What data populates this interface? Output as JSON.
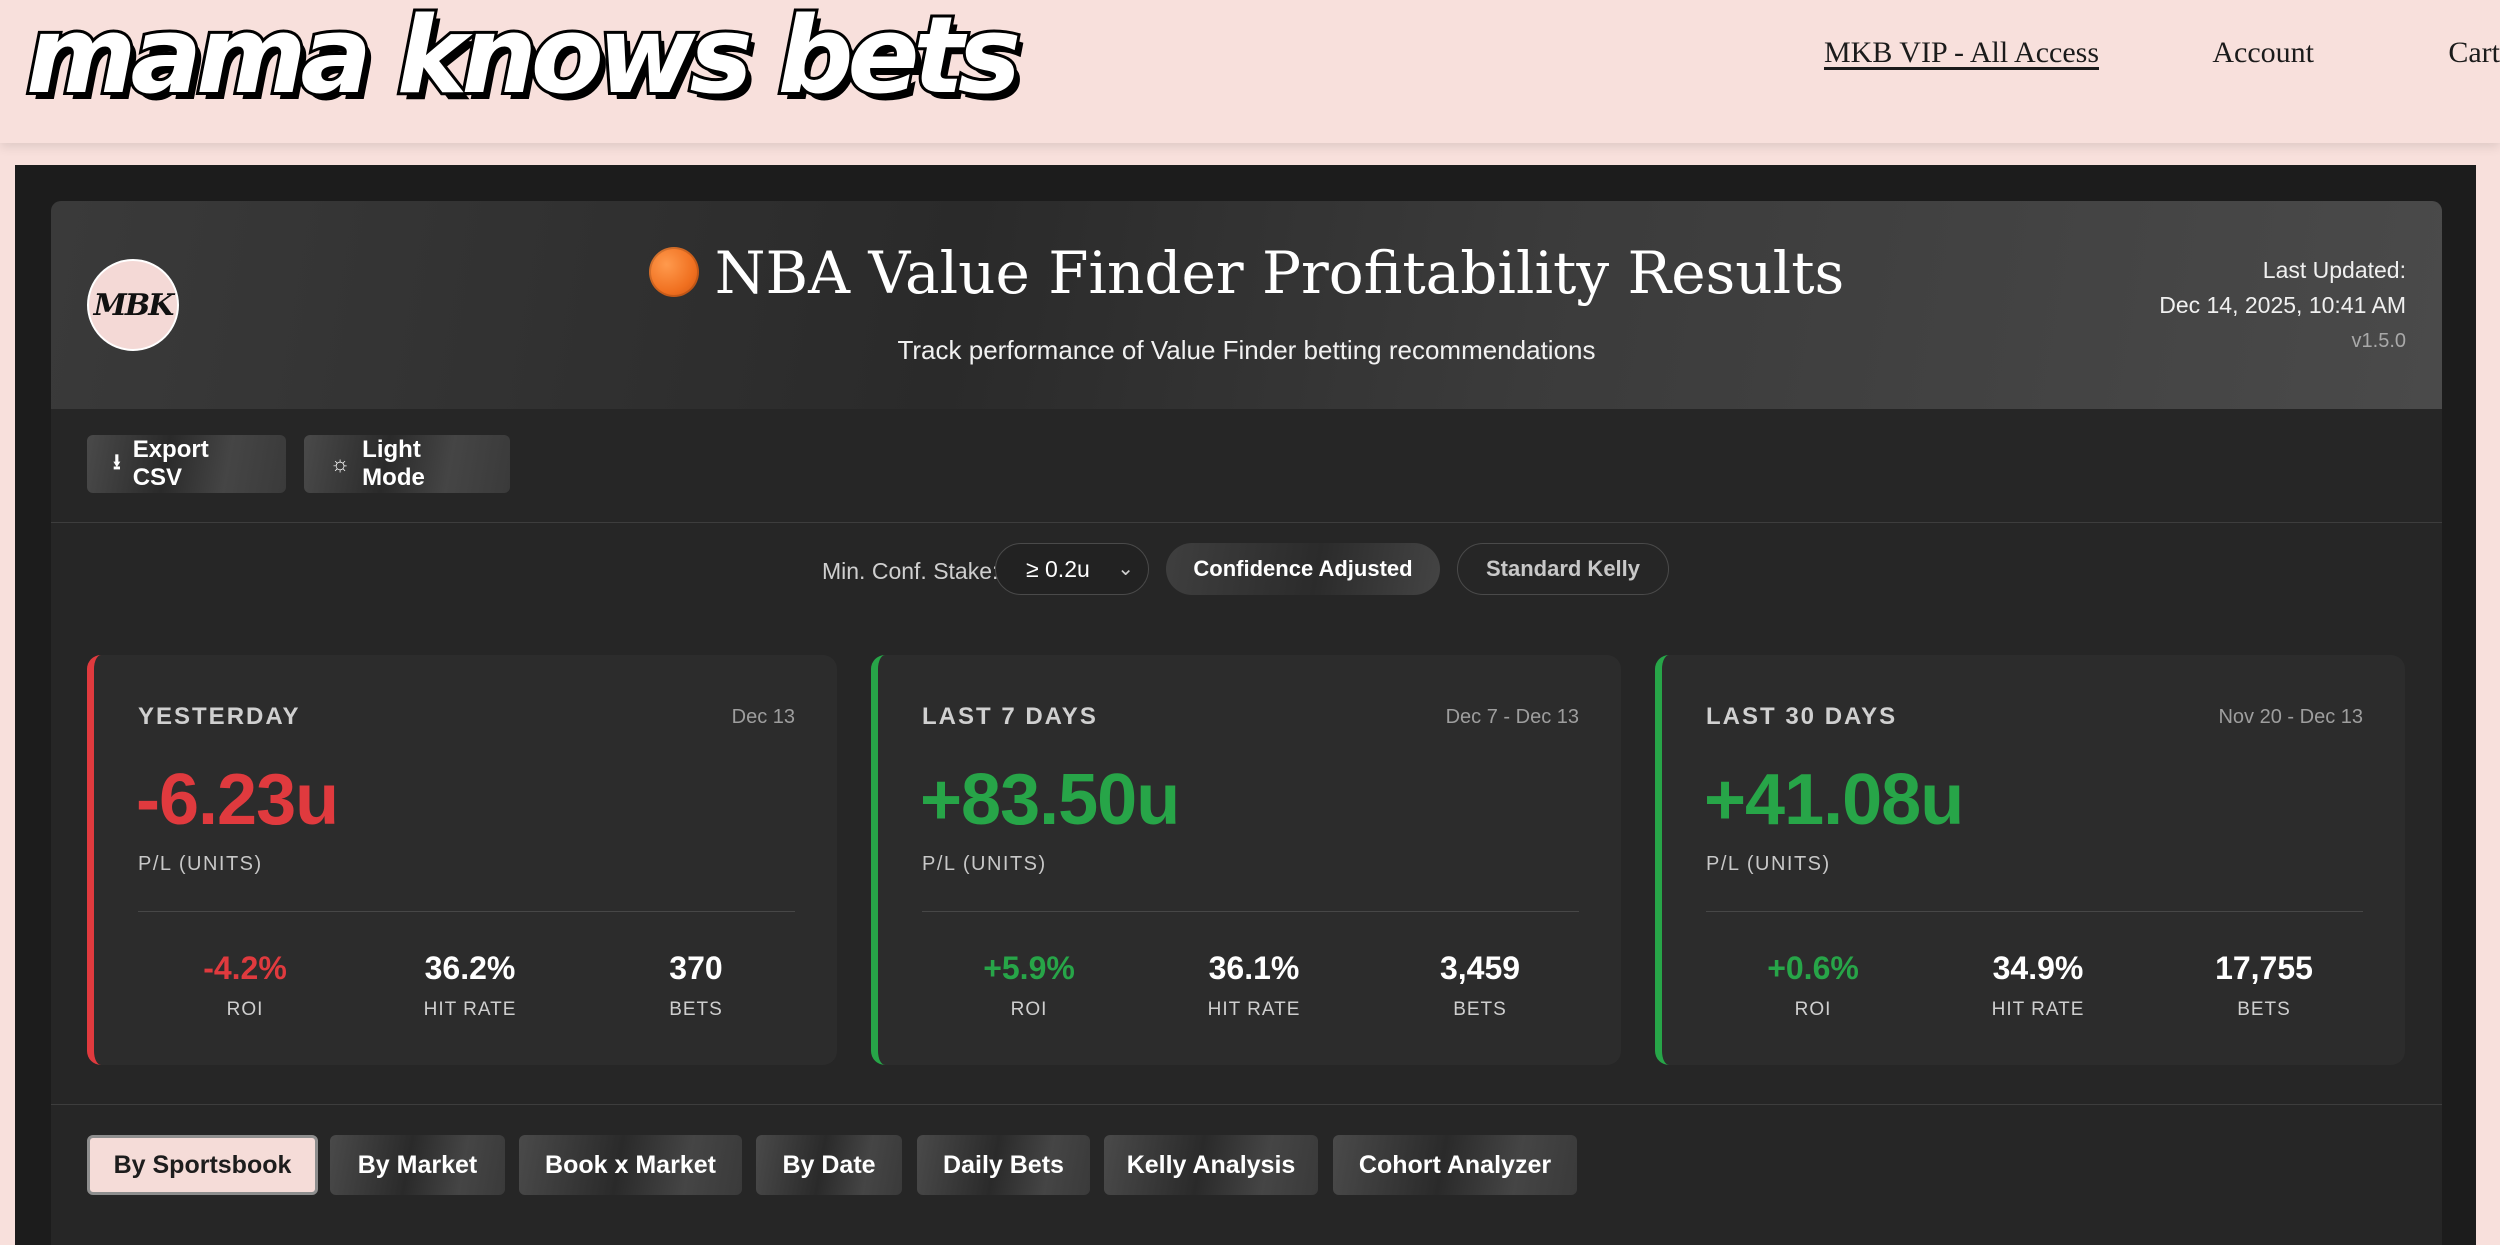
{
  "site": {
    "brand": "mama knows bets",
    "nav": [
      "MKB VIP - All Access",
      "Account",
      "Cart"
    ]
  },
  "hero": {
    "logo_text": "MBK",
    "title": "NBA Value Finder Profitability Results",
    "subtitle": "Track performance of Value Finder betting recommendations",
    "updated_label": "Last Updated:",
    "updated_value": "Dec 14, 2025, 10:41 AM",
    "version": "v1.5.0"
  },
  "toolbar": {
    "export": "Export CSV",
    "theme": "Light Mode"
  },
  "filters": {
    "label": "Min. Conf. Stake:",
    "select_value": "≥ 0.2u",
    "mode_active": "Confidence Adjusted",
    "mode_inactive": "Standard Kelly"
  },
  "cards": [
    {
      "period": "YESTERDAY",
      "range": "Dec 13",
      "pl": "-6.23u",
      "pl_label": "P/L (UNITS)",
      "roi": "-4.2%",
      "roi_label": "ROI",
      "hit": "36.2%",
      "hit_label": "HIT RATE",
      "bets": "370",
      "bets_label": "BETS"
    },
    {
      "period": "LAST 7 DAYS",
      "range": "Dec 7 - Dec 13",
      "pl": "+83.50u",
      "pl_label": "P/L (UNITS)",
      "roi": "+5.9%",
      "roi_label": "ROI",
      "hit": "36.1%",
      "hit_label": "HIT RATE",
      "bets": "3,459",
      "bets_label": "BETS"
    },
    {
      "period": "LAST 30 DAYS",
      "range": "Nov 20 - Dec 13",
      "pl": "+41.08u",
      "pl_label": "P/L (UNITS)",
      "roi": "+0.6%",
      "roi_label": "ROI",
      "hit": "34.9%",
      "hit_label": "HIT RATE",
      "bets": "17,755",
      "bets_label": "BETS"
    }
  ],
  "tabs": [
    "By Sportsbook",
    "By Market",
    "Book x Market",
    "By Date",
    "Daily Bets",
    "Kelly Analysis",
    "Cohort Analyzer"
  ],
  "colors": {
    "positive": "#27a548",
    "negative": "#e03a3e",
    "accent_pink": "#f8e0dc"
  }
}
